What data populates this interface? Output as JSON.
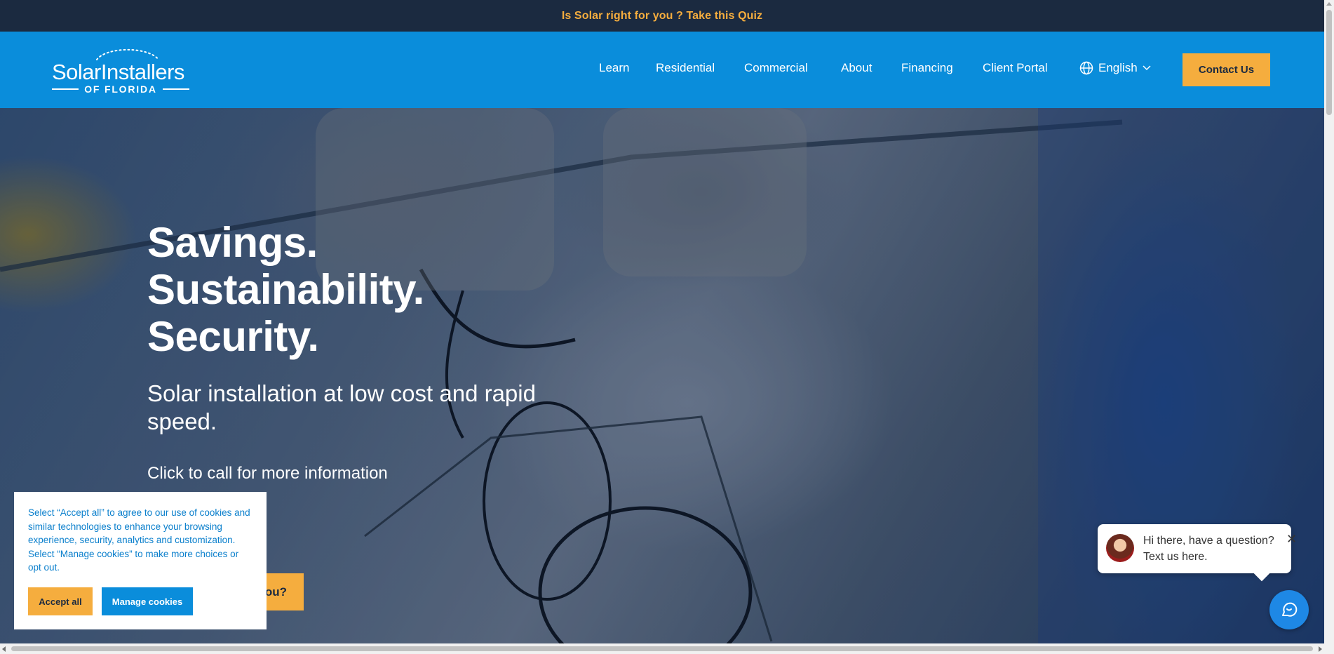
{
  "announcement": {
    "text": "Is Solar right for you ? Take this Quiz"
  },
  "header": {
    "logo": {
      "main": "SolarInstallers",
      "sub": "OF FLORIDA"
    },
    "nav": [
      {
        "label": "Learn"
      },
      {
        "label": "Residential"
      },
      {
        "label": "Commercial"
      },
      {
        "label": "About"
      },
      {
        "label": "Financing"
      },
      {
        "label": "Client Portal"
      }
    ],
    "language": {
      "label": "English",
      "icon": "globe-icon"
    },
    "contact_label": "Contact Us"
  },
  "hero": {
    "headline": [
      "Savings.",
      "Sustainability.",
      "Security."
    ],
    "subheadline": "Solar installation at low cost and rapid speed.",
    "call_text": "Click to call for more information",
    "cta_visible_text": "ou?"
  },
  "cookie_banner": {
    "text": "Select “Accept all” to agree to our use of cookies and similar technologies to enhance your browsing experience, security, analytics and customization. Select “Manage cookies” to make more choices or opt out.",
    "accept_label": "Accept all",
    "manage_label": "Manage cookies"
  },
  "chat": {
    "line1": "Hi there, have a question?",
    "line2": "Text us here.",
    "close_symbol": "✕"
  },
  "colors": {
    "accent": "#f5ad3e",
    "header_blue": "#0a8ddb",
    "topbar": "#1b2a40",
    "chat_blue": "#1e88e5"
  }
}
